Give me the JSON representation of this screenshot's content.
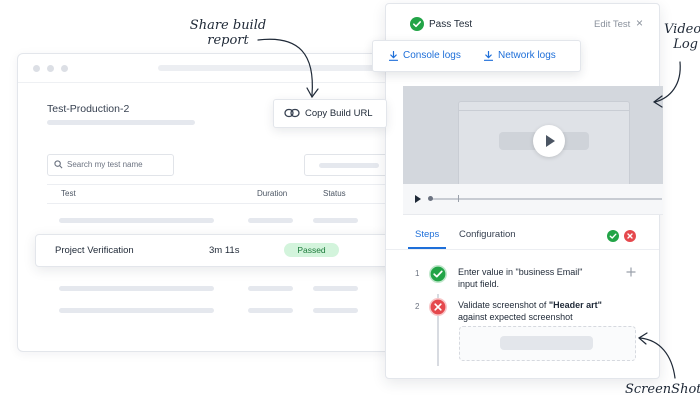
{
  "annotations": {
    "share_build_line1": "Share build",
    "share_build_line2": "report",
    "video_log_line1": "Video",
    "video_log_line2": "Log",
    "screenshot": "ScreenShot"
  },
  "dashboard": {
    "project_title": "Test-Production-2",
    "search": {
      "placeholder": "Search my test name",
      "icon": "search-icon"
    },
    "table": {
      "headers": [
        "Test",
        "Duration",
        "Status"
      ]
    }
  },
  "highlighted_row": {
    "name": "Project Verification",
    "duration": "3m 11s",
    "status": "Passed",
    "status_color": "#1c7a3a",
    "status_bg": "#d3f4dc"
  },
  "copy_build_url": {
    "label": "Copy Build URL",
    "icon": "link-icon"
  },
  "logs": {
    "console_label": "Console logs",
    "network_label": "Network logs",
    "icon": "download-icon"
  },
  "panel": {
    "title": "Pass Test",
    "edit_label": "Edit Test",
    "close_glyph": "×",
    "tabs": [
      "Steps",
      "Configuration"
    ],
    "active_tab": "Steps",
    "video": {
      "progress": 0.02
    },
    "steps": [
      {
        "number": "1",
        "status": "passed",
        "text_plain_1": "Enter value in \"business Email\"",
        "text_plain_2": "input field."
      },
      {
        "number": "2",
        "status": "failed",
        "text_pre": "Validate screenshot of ",
        "text_bold": "\"Header art\"",
        "text_line2": "against expected screenshot"
      }
    ]
  },
  "colors": {
    "accent": "#1e6fd9",
    "pass": "#22a447",
    "fail": "#e5484d"
  }
}
